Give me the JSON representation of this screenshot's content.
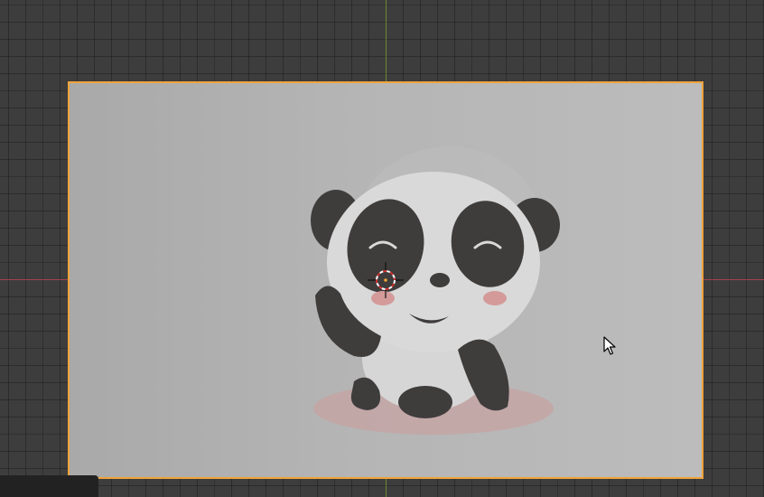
{
  "viewport": {
    "background_color": "#3d3d3d",
    "x_axis_color": "#a6414c",
    "y_axis_color": "#6b8a2c"
  },
  "image_plane": {
    "outline_color": "#f0a33a",
    "selected": true,
    "image_subject": "panda-illustration"
  },
  "icons": {
    "cursor_3d": "3d-cursor-icon",
    "mouse": "mouse-pointer-icon"
  },
  "colors": {
    "panda_dark": "#3f3c3c",
    "panda_white": "#d9d9d9",
    "blush": "#d79a9a",
    "shadow": "#cfa4a4"
  }
}
